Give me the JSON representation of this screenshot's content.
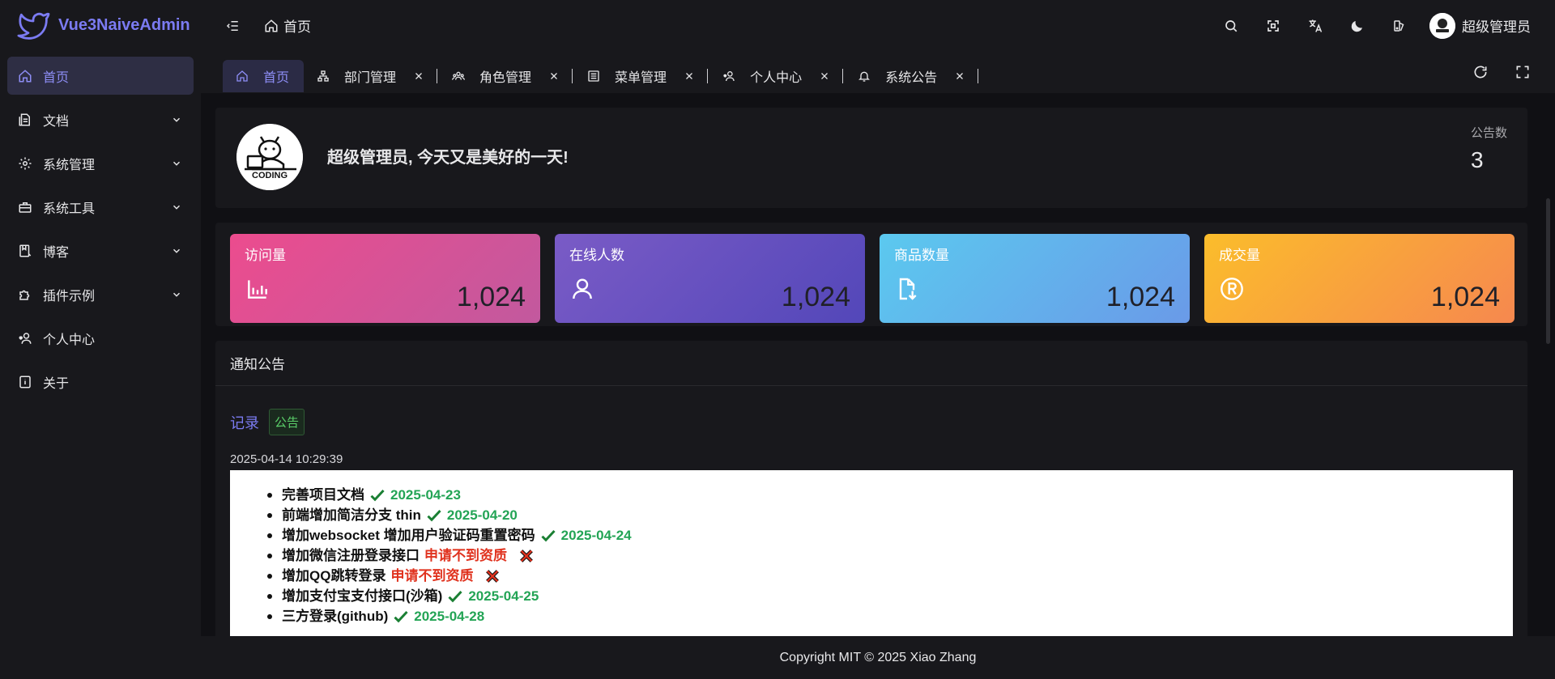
{
  "app": {
    "name": "Vue3NaiveAdmin",
    "brand_color": "#7b7bf2"
  },
  "header": {
    "breadcrumb": "首页",
    "user_name": "超级管理员",
    "icons": [
      "search-icon",
      "fullscreen-icon",
      "translate-icon",
      "dark-mode-icon",
      "theme-icon"
    ]
  },
  "sidebar": {
    "items": [
      {
        "label": "首页",
        "icon": "home-icon",
        "active": true,
        "expandable": false
      },
      {
        "label": "文档",
        "icon": "document-icon",
        "expandable": true
      },
      {
        "label": "系统管理",
        "icon": "gear-icon",
        "expandable": true
      },
      {
        "label": "系统工具",
        "icon": "toolbox-icon",
        "expandable": true
      },
      {
        "label": "博客",
        "icon": "blog-icon",
        "expandable": true
      },
      {
        "label": "插件示例",
        "icon": "puzzle-icon",
        "expandable": true
      },
      {
        "label": "个人中心",
        "icon": "user-heart-icon",
        "expandable": false
      },
      {
        "label": "关于",
        "icon": "info-icon",
        "expandable": false
      }
    ]
  },
  "tabs": [
    {
      "label": "首页",
      "active": true,
      "closable": false
    },
    {
      "label": "部门管理",
      "closable": true
    },
    {
      "label": "角色管理",
      "closable": true
    },
    {
      "label": "菜单管理",
      "closable": true
    },
    {
      "label": "个人中心",
      "closable": true
    },
    {
      "label": "系统公告",
      "closable": true
    }
  ],
  "welcome": {
    "message": "超级管理员, 今天又是美好的一天!",
    "avatar_text": "CODING",
    "notice_label": "公告数",
    "notice_count": "3"
  },
  "stats": [
    {
      "title": "访问量",
      "value": "1,024",
      "icon": "bar-chart-icon"
    },
    {
      "title": "在线人数",
      "value": "1,024",
      "icon": "user-icon"
    },
    {
      "title": "商品数量",
      "value": "1,024",
      "icon": "file-download-icon"
    },
    {
      "title": "成交量",
      "value": "1,024",
      "icon": "registered-icon"
    }
  ],
  "notices": {
    "title": "通知公告",
    "link": "记录",
    "tag": "公告",
    "date": "2025-04-14 10:29:39",
    "items": [
      {
        "text": "完善项目文档",
        "status": "ok",
        "date": "2025-04-23"
      },
      {
        "text": "前端增加简洁分支 thin",
        "status": "ok",
        "date": "2025-04-20"
      },
      {
        "text": "增加websocket 增加用户验证码重置密码",
        "status": "ok",
        "date": "2025-04-24"
      },
      {
        "text": "增加微信注册登录接口",
        "status": "fail",
        "note": "申请不到资质"
      },
      {
        "text": "增加QQ跳转登录",
        "status": "fail",
        "note": "申请不到资质"
      },
      {
        "text": "增加支付宝支付接口(沙箱)",
        "status": "ok",
        "date": "2025-04-25"
      },
      {
        "text": "三方登录(github)",
        "status": "ok",
        "date": "2025-04-28"
      }
    ]
  },
  "footer": {
    "copyright": "Copyright MIT © 2025 Xiao Zhang"
  }
}
